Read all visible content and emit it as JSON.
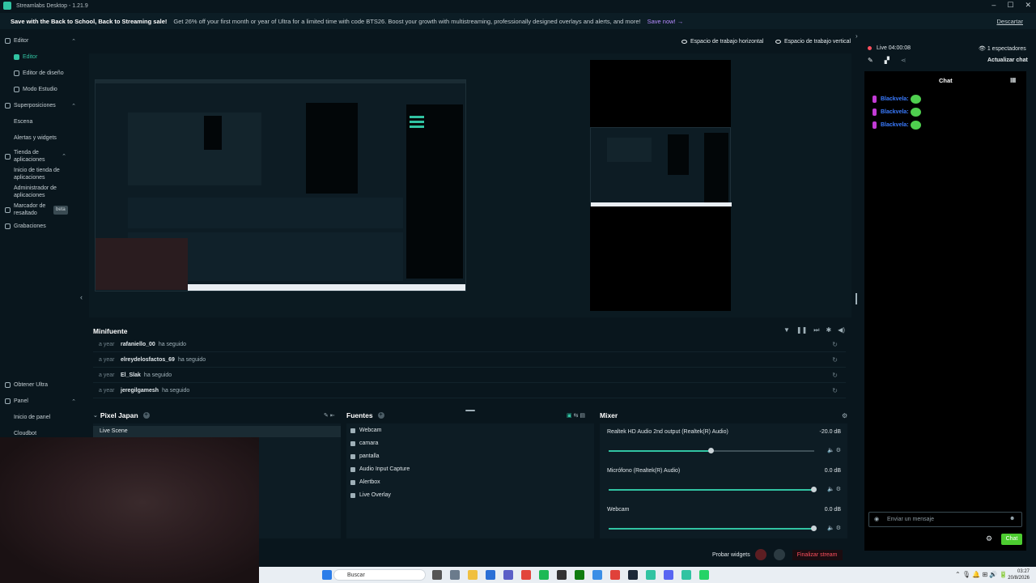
{
  "window": {
    "title": "Streamlabs Desktop - 1.21.9",
    "controls": [
      "–",
      "☐",
      "✕"
    ]
  },
  "banner": {
    "headline": "Save with the Back to School, Back to Streaming sale!",
    "message": "Get 26% off your first month or year of Ultra for a limited time with code BTS26. Boost your growth with multistreaming, professionally designed overlays and alerts, and more!",
    "cta": "Save now! →",
    "dismiss": "Descartar"
  },
  "sidebar": {
    "editor": "Editor",
    "editor_child": "Editor",
    "layout_editor": "Editor de diseño",
    "studio_mode": "Modo Estudio",
    "overlays": "Superposiciones",
    "scene": "Escena",
    "alerts": "Alertas y widgets",
    "app_store": "Tienda de aplicaciones",
    "app_store_home": "Inicio de tienda de aplicaciones",
    "app_manager": "Administrador de aplicaciones",
    "highlighter": "Marcador de resaltado",
    "beta": "beta",
    "recordings": "Grabaciones",
    "get_ultra": "Obtener Ultra",
    "dashboard": "Panel",
    "dashboard_home": "Inicio de panel",
    "cloudbot": "Cloudbot"
  },
  "workspace": {
    "horizontal": "Espacio de trabajo horizontal",
    "vertical": "Espacio de trabajo vertical"
  },
  "minifuente": {
    "title": "Minifuente",
    "events": [
      {
        "time": "a year",
        "name": "rafaniello_00",
        "action": "ha seguido"
      },
      {
        "time": "a year",
        "name": "elreydelosfactos_69",
        "action": "ha seguido"
      },
      {
        "time": "a year",
        "name": "El_Slak",
        "action": "ha seguido"
      },
      {
        "time": "a year",
        "name": "jeregilgamesh",
        "action": "ha seguido"
      }
    ]
  },
  "scenes": {
    "title": "Pixel Japan",
    "items": [
      "Live Scene"
    ]
  },
  "sources": {
    "title": "Fuentes",
    "items": [
      "Webcam",
      "camara",
      "pantalla",
      "Audio Input Capture",
      "Alertbox",
      "Live Overlay"
    ]
  },
  "mixer": {
    "title": "Mixer",
    "channels": [
      {
        "name": "Realtek HD Audio 2nd output (Realtek(R) Audio)",
        "db": "-20.0 dB",
        "level": 0.5
      },
      {
        "name": "Micrófono (Realtek(R) Audio)",
        "db": "0.0 dB",
        "level": 1.0
      },
      {
        "name": "Webcam",
        "db": "0.0 dB",
        "level": 1.0
      }
    ]
  },
  "footer": {
    "test_widgets": "Probar widgets",
    "rec": "REC",
    "end_stream": "Finalizar stream"
  },
  "chat_panel": {
    "live_time": "Live 04:00:08",
    "viewers": "1 espectadores",
    "refresh": "Actualizar chat",
    "tab": "Chat",
    "messages": [
      {
        "user": "Blackvela:"
      },
      {
        "user": "Blackvela:"
      },
      {
        "user": "Blackvela:"
      }
    ],
    "input_placeholder": "Enviar un mensaje",
    "send": "Chat"
  },
  "taskbar": {
    "search": "Buscar",
    "time": "03:27",
    "date": "20/8/2026"
  },
  "colors": {
    "accent": "#31c3a2",
    "live": "#ff4f5e",
    "send": "#4ccc30",
    "username": "#3a7bff"
  }
}
